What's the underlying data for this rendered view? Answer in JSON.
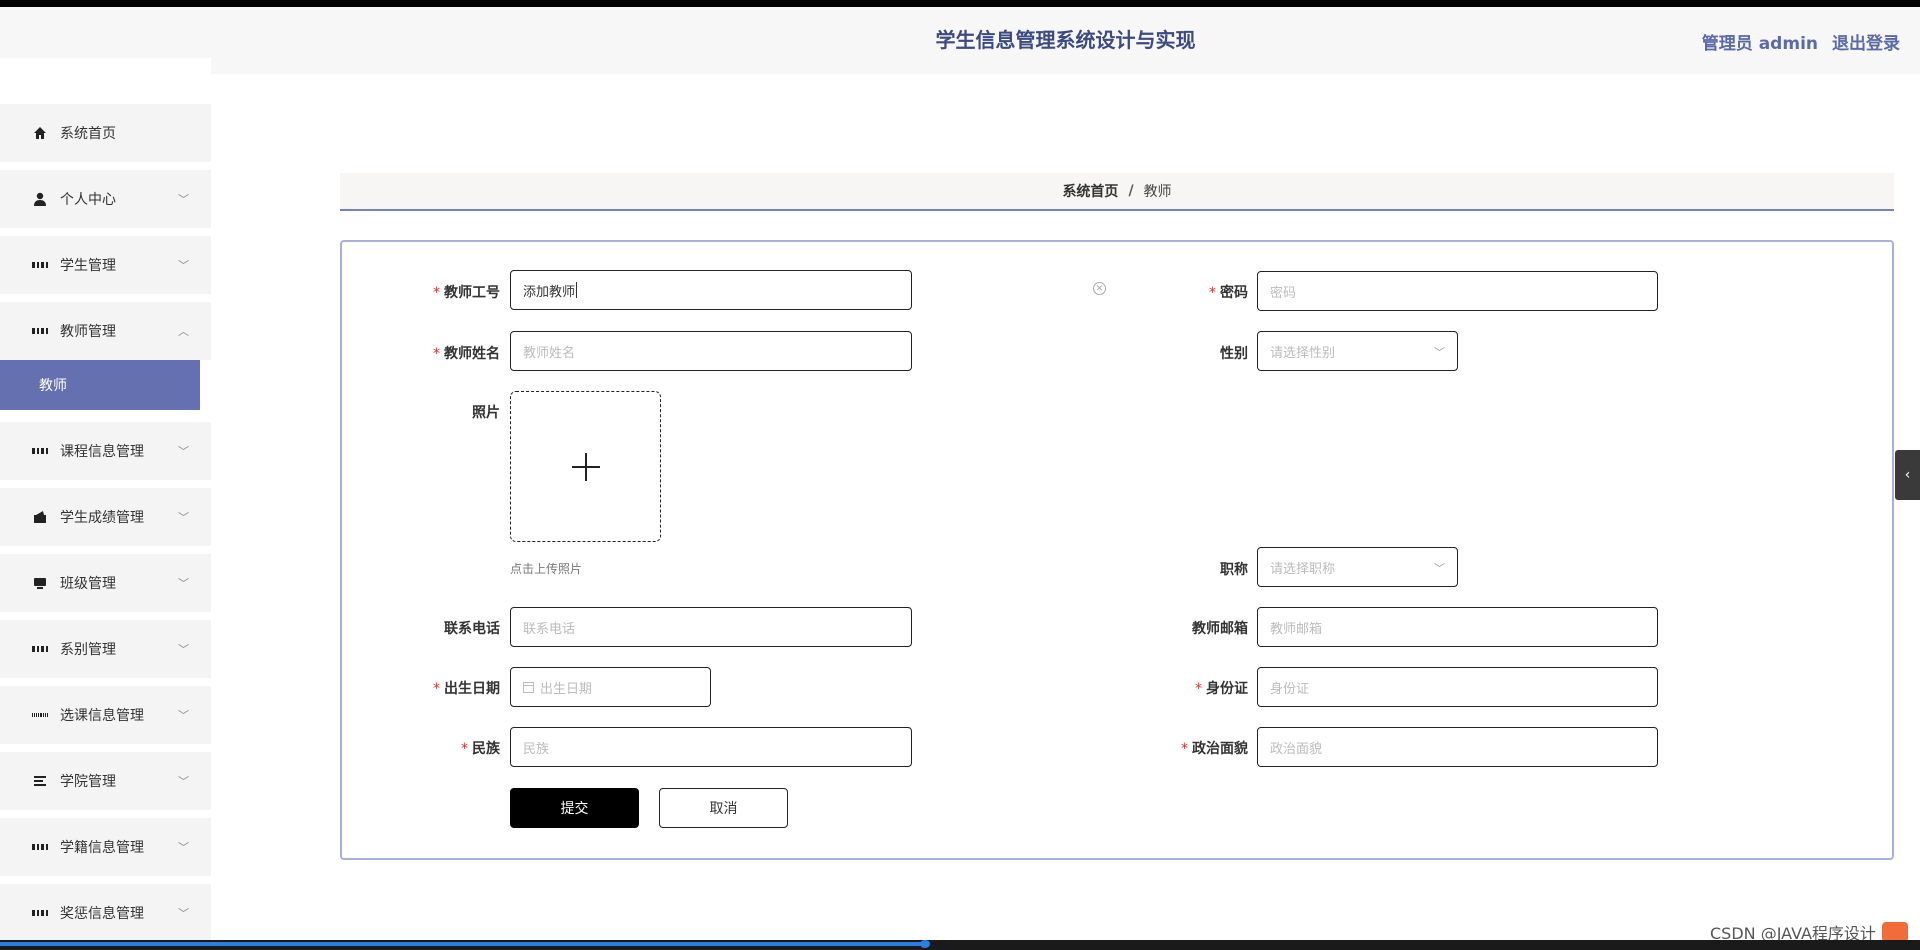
{
  "header": {
    "title": "学生信息管理系统设计与实现",
    "admin_label": "管理员 admin",
    "logout_label": "退出登录"
  },
  "sidebar": {
    "items": [
      {
        "label": "系统首页",
        "icon": "home-icon"
      },
      {
        "label": "个人中心",
        "icon": "user-icon"
      },
      {
        "label": "学生管理",
        "icon": "grid-icon"
      },
      {
        "label": "教师管理",
        "icon": "grid-icon"
      },
      {
        "label": "教师",
        "icon": ""
      },
      {
        "label": "课程信息管理",
        "icon": "grid-icon"
      },
      {
        "label": "学生成绩管理",
        "icon": "wallet-icon"
      },
      {
        "label": "班级管理",
        "icon": "monitor-icon"
      },
      {
        "label": "系别管理",
        "icon": "grid-icon"
      },
      {
        "label": "选课信息管理",
        "icon": "grid9-icon"
      },
      {
        "label": "学院管理",
        "icon": "list-icon"
      },
      {
        "label": "学籍信息管理",
        "icon": "grid-icon"
      },
      {
        "label": "奖惩信息管理",
        "icon": "grid-icon"
      }
    ]
  },
  "breadcrumb": {
    "home": "系统首页",
    "separator": "/",
    "current": "教师"
  },
  "form": {
    "teacher_id": {
      "label": "教师工号",
      "value": "添加教师"
    },
    "password": {
      "label": "密码",
      "placeholder": "密码"
    },
    "teacher_name": {
      "label": "教师姓名",
      "placeholder": "教师姓名"
    },
    "gender": {
      "label": "性别",
      "placeholder": "请选择性别"
    },
    "photo": {
      "label": "照片",
      "hint": "点击上传照片"
    },
    "title": {
      "label": "职称",
      "placeholder": "请选择职称"
    },
    "phone": {
      "label": "联系电话",
      "placeholder": "联系电话"
    },
    "email": {
      "label": "教师邮箱",
      "placeholder": "教师邮箱"
    },
    "birthdate": {
      "label": "出生日期",
      "placeholder": "出生日期"
    },
    "id_card": {
      "label": "身份证",
      "placeholder": "身份证"
    },
    "ethnicity": {
      "label": "民族",
      "placeholder": "民族"
    },
    "political_status": {
      "label": "政治面貌",
      "placeholder": "政治面貌"
    },
    "submit_label": "提交",
    "cancel_label": "取消"
  },
  "watermark": "CSDN @JAVA程序设计",
  "colors": {
    "accent": "#6470b0",
    "title": "#3c4a82",
    "required": "#e03030"
  }
}
